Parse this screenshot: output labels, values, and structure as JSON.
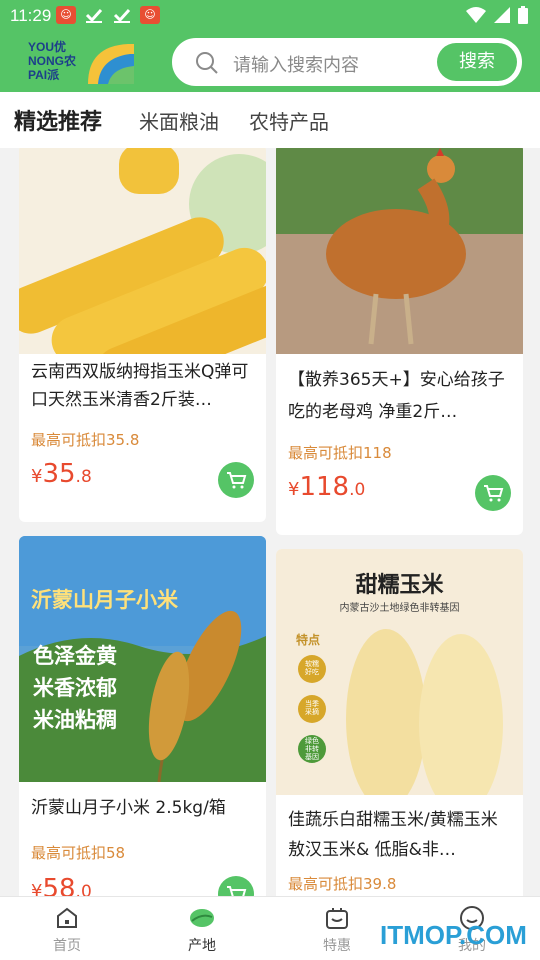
{
  "status": {
    "time": "11:29"
  },
  "header": {
    "logo_lines": [
      "YOU优",
      "NONG农",
      "PAI派"
    ],
    "search_placeholder": "请输入搜索内容",
    "search_button": "搜索"
  },
  "tabs": [
    {
      "label": "精选推荐",
      "active": true
    },
    {
      "label": "米面粮油",
      "active": false
    },
    {
      "label": "农特产品",
      "active": false
    }
  ],
  "products": [
    {
      "title": "云南西双版纳拇指玉米Q弹可口天然玉米清香2斤装…",
      "deduct": "最高可抵扣35.8",
      "currency": "¥",
      "price_int": "35",
      "price_dec": ".8"
    },
    {
      "title": "【散养365天+】安心给孩子吃的老母鸡 净重2斤…",
      "deduct": "最高可抵扣118",
      "currency": "¥",
      "price_int": "118",
      "price_dec": ".0"
    },
    {
      "title": "沂蒙山月子小米 2.5kg/箱",
      "deduct": "最高可抵扣58",
      "currency": "¥",
      "price_int": "58",
      "price_dec": ".0",
      "image_text": [
        "沂蒙山月子小米",
        "色泽金黄",
        "米香浓郁",
        "米油粘稠"
      ]
    },
    {
      "title": "佳蔬乐白甜糯玉米/黄糯玉米 敖汉玉米& 低脂&非…",
      "deduct": "最高可抵扣39.8",
      "image_text": [
        "甜糯玉米",
        "内蒙古沙土地绿色非转基因",
        "特点",
        "软糯好吃",
        "当季采摘",
        "绿色非转基因"
      ]
    }
  ],
  "bottom_nav": [
    {
      "label": "首页",
      "icon": "home-icon",
      "active": false
    },
    {
      "label": "产地",
      "icon": "leaf-icon",
      "active": true
    },
    {
      "label": "特惠",
      "icon": "gift-icon",
      "active": false
    },
    {
      "label": "我的",
      "icon": "user-icon",
      "active": false
    }
  ],
  "watermark": "ITMOP.COM",
  "colors": {
    "brand": "#55c466",
    "price": "#e84a2e",
    "deduct": "#d98a3a"
  }
}
